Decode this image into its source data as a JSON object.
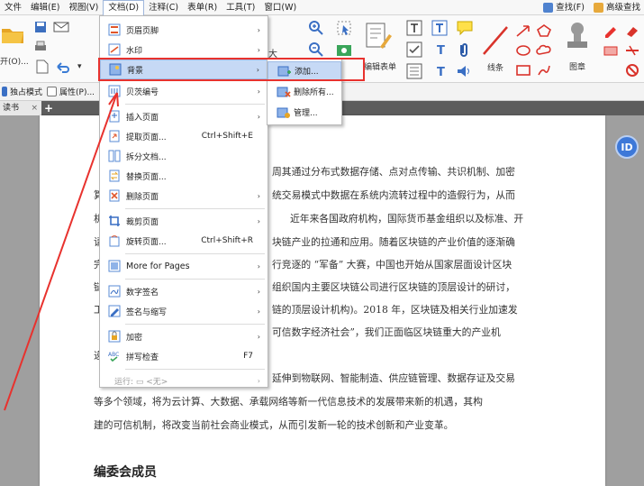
{
  "menubar": {
    "items": [
      "文件",
      "编辑(E)",
      "视图(V)",
      "文档(D)",
      "注释(C)",
      "表单(R)",
      "工具(T)",
      "窗口(W)"
    ],
    "right_items": [
      "查找(F)",
      "高级查找"
    ]
  },
  "toolbar": {
    "open_label": "开(O)...",
    "font_fragment": "大",
    "edit_form_label": "编辑表单",
    "lines_label": "线条",
    "stamp_label": "图章"
  },
  "toolbar2": {
    "exclusive_mode": "独占模式",
    "properties": "属性(P)..."
  },
  "tab": {
    "label": "读书",
    "close": "×",
    "add": "+"
  },
  "document": {
    "lines": [
      "周其通过分布式数据存储、点对点传输、共识机制、加密",
      "统交易模式中数据在系统内流转过程中的造假行为，从而",
      "近年来各国政府机构，国际货币基金组织以及标准、开",
      "块链产业的拉通和应用。随着区块链的产业价值的逐渐确",
      "行竞逐的 “军备” 大赛，中国也开始从国家层面设计区块",
      "组织国内主要区块链公司进行区块链的顶层设计的研讨，",
      "链的顶层设计机构)。2018 年，区块链及相关行业加速发",
      "可信数字经济社会”，我们正面临区块链重大的产业机",
      "延伸到物联网、智能制造、供应链管理、数据存证及交易",
      "等多个领域，将为云计算、大数据、承载网络等新一代信息技术的发展带来新的机遇，其构",
      "建的可信机制，将改变当前社会商业模式，从而引发新一轮的技术创新和产业变革。"
    ],
    "left_fragments": [
      "算",
      "机",
      "请",
      "完",
      "链",
      "工",
      "递"
    ],
    "heading": "编委会成员",
    "side_button": "ID"
  },
  "menu": {
    "items": [
      {
        "label": "页眉页脚",
        "shortcut": "",
        "submenu": true
      },
      {
        "label": "水印",
        "shortcut": "",
        "submenu": true
      },
      {
        "label": "背景",
        "shortcut": "",
        "submenu": true,
        "highlight": true
      },
      {
        "label": "贝茨编号",
        "shortcut": "",
        "submenu": true
      },
      {
        "label": "插入页面",
        "shortcut": "",
        "submenu": true
      },
      {
        "label": "提取页面...",
        "shortcut": "Ctrl+Shift+E",
        "submenu": false
      },
      {
        "label": "拆分文档...",
        "shortcut": "",
        "submenu": false
      },
      {
        "label": "替换页面...",
        "shortcut": "",
        "submenu": false
      },
      {
        "label": "删除页面",
        "shortcut": "",
        "submenu": true
      },
      {
        "label": "裁剪页面",
        "shortcut": "",
        "submenu": true
      },
      {
        "label": "旋转页面...",
        "shortcut": "Ctrl+Shift+R",
        "submenu": false
      },
      {
        "label": "More for Pages",
        "shortcut": "",
        "submenu": true
      },
      {
        "label": "数字签名",
        "shortcut": "",
        "submenu": true
      },
      {
        "label": "签名与缩写",
        "shortcut": "",
        "submenu": true
      },
      {
        "label": "加密",
        "shortcut": "",
        "submenu": true
      },
      {
        "label": "拼写检查",
        "shortcut": "F7",
        "submenu": false
      },
      {
        "label": "运行: ▭ <无>",
        "shortcut": "",
        "submenu": true,
        "dim": true
      }
    ]
  },
  "submenu": {
    "items": [
      {
        "label": "添加...",
        "highlight": true
      },
      {
        "label": "删除所有..."
      },
      {
        "label": "管理..."
      }
    ]
  },
  "colors": {
    "highlight": "#c6d9f5",
    "annotation_red": "#e8322e",
    "accent_blue": "#3d78d8"
  }
}
